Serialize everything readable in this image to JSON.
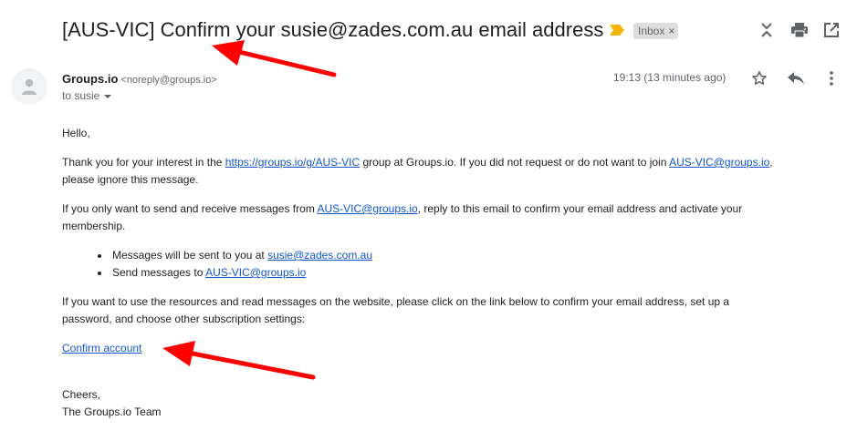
{
  "subject": "[AUS-VIC] Confirm your susie@zades.com.au email address",
  "label": "Inbox",
  "label_remove": "×",
  "sender": {
    "name": "Groups.io",
    "email": "<noreply@groups.io>",
    "to": "to susie"
  },
  "timestamp": "19:13 (13 minutes ago)",
  "body": {
    "greeting": "Hello,",
    "p1": {
      "pre": "Thank you for your interest in the ",
      "link": "https://groups.io/g/AUS-VIC",
      "mid": " group at Groups.io. If you did not request or do not want to join ",
      "link2": "AUS-VIC@groups.io",
      "post": ",",
      "line2": "please ignore this message."
    },
    "p2": {
      "pre": "If you only want to send and receive messages from ",
      "link": "AUS-VIC@groups.io",
      "post": ", reply to this email to confirm your email address and activate your",
      "line2": "membership."
    },
    "bullets": [
      {
        "pre": "Messages will be sent to you at ",
        "link": "susie@zades.com.au"
      },
      {
        "pre": "Send messages to ",
        "link": "AUS-VIC@groups.io"
      }
    ],
    "p3": {
      "line1": "If you want to use the resources and read messages on the website, please click on the link below to confirm your email address, set up a",
      "line2": "password, and choose other subscription settings:"
    },
    "confirm_link": "Confirm account",
    "closing1": "Cheers,",
    "closing2": "The Groups.io Team"
  },
  "icons": {
    "expand": "unfold-icon",
    "print": "print-icon",
    "newwin": "open-in-new-window-icon",
    "star": "star-icon",
    "reply": "reply-icon",
    "more": "more-vert-icon",
    "avatar": "person-icon",
    "importance": "importance-marker-icon"
  },
  "colors": {
    "link": "#1155cc",
    "annotation_arrow": "#ff0000",
    "importance": "#f4b400",
    "chip_bg": "#dddddd"
  }
}
